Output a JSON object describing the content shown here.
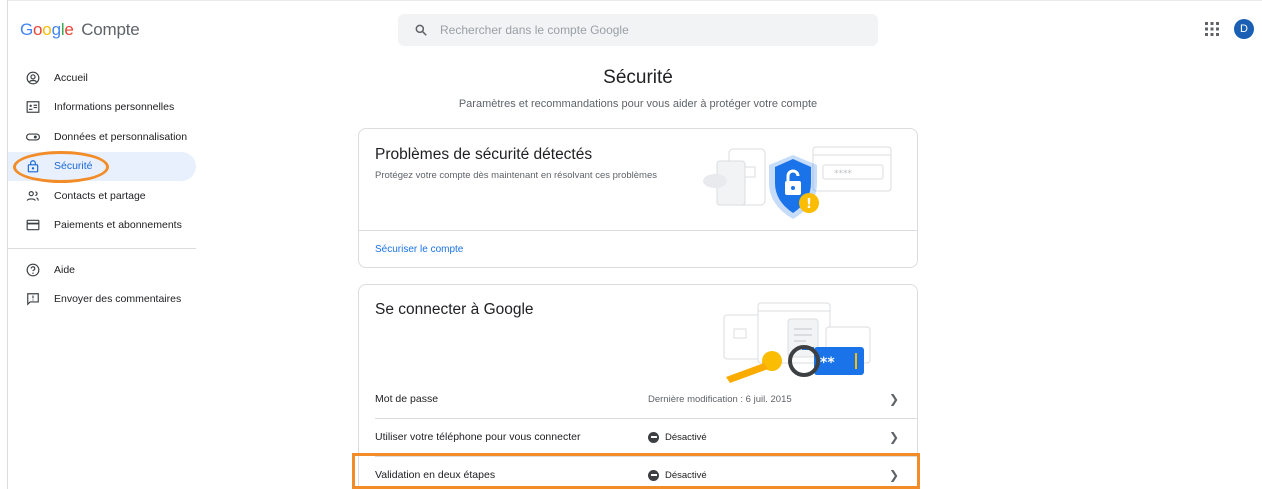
{
  "header": {
    "logo_letters": [
      "G",
      "o",
      "o",
      "g",
      "l",
      "e"
    ],
    "product": "Compte",
    "search_placeholder": "Rechercher dans le compte Google",
    "avatar_initial": "D"
  },
  "sidebar": {
    "items": [
      {
        "label": "Accueil",
        "icon": "account-circle-icon"
      },
      {
        "label": "Informations personnelles",
        "icon": "id-card-icon"
      },
      {
        "label": "Données et personnalisation",
        "icon": "toggle-icon"
      },
      {
        "label": "Sécurité",
        "icon": "lock-icon",
        "active": true
      },
      {
        "label": "Contacts et partage",
        "icon": "people-icon"
      },
      {
        "label": "Paiements et abonnements",
        "icon": "credit-card-icon"
      }
    ],
    "secondary": [
      {
        "label": "Aide",
        "icon": "help-icon"
      },
      {
        "label": "Envoyer des commentaires",
        "icon": "feedback-icon"
      }
    ]
  },
  "main": {
    "title": "Sécurité",
    "subtitle": "Paramètres et recommandations pour vous aider à protéger votre compte",
    "issues_card": {
      "title": "Problèmes de sécurité détectés",
      "description": "Protégez votre compte dès maintenant en résolvant ces problèmes",
      "link": "Sécuriser le compte"
    },
    "signin_card": {
      "title": "Se connecter à Google",
      "rows": [
        {
          "label": "Mot de passe",
          "value": "Dernière modification : 6 juil. 2015"
        },
        {
          "label": "Utiliser votre téléphone pour vous connecter",
          "value": "Désactivé"
        },
        {
          "label": "Validation en deux étapes",
          "value": "Désactivé"
        }
      ]
    }
  },
  "colors": {
    "accent": "#1a73e8",
    "active_bg": "#e8f0fe",
    "highlight": "#f28c28"
  }
}
